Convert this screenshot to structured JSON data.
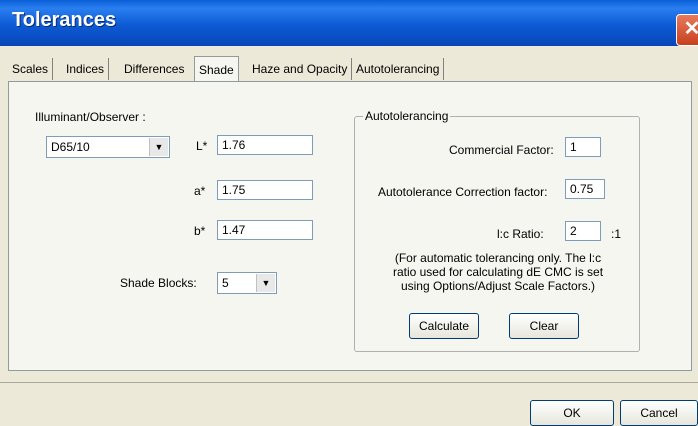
{
  "window": {
    "title": "Tolerances",
    "close_icon": "✕"
  },
  "tabs": [
    {
      "label": "Scales"
    },
    {
      "label": "Indices"
    },
    {
      "label": "Differences"
    },
    {
      "label": "Shade",
      "active": true
    },
    {
      "label": "Haze and Opacity"
    },
    {
      "label": "Autotolerancing"
    }
  ],
  "shade": {
    "illuminant_label": "Illuminant/Observer :",
    "illuminant_value": "D65/10",
    "l_label": "L*",
    "l_value": "1.76",
    "a_label": "a*",
    "a_value": "1.75",
    "b_label": "b*",
    "b_value": "1.47",
    "shade_blocks_label": "Shade Blocks:",
    "shade_blocks_value": "5"
  },
  "autotol": {
    "group_title": "Autotolerancing",
    "commercial_label": "Commercial Factor:",
    "commercial_value": "1",
    "correction_label": "Autotolerance Correction factor:",
    "correction_value": "0.75",
    "ratio_label": "l:c Ratio:",
    "ratio_value": "2",
    "ratio_suffix": ":1",
    "note": "(For automatic tolerancing only.  The l:c ratio used for calculating dE CMC is set using Options/Adjust Scale Factors.)",
    "calculate_label": "Calculate",
    "clear_label": "Clear"
  },
  "footer": {
    "ok_label": "OK",
    "cancel_label": "Cancel"
  }
}
